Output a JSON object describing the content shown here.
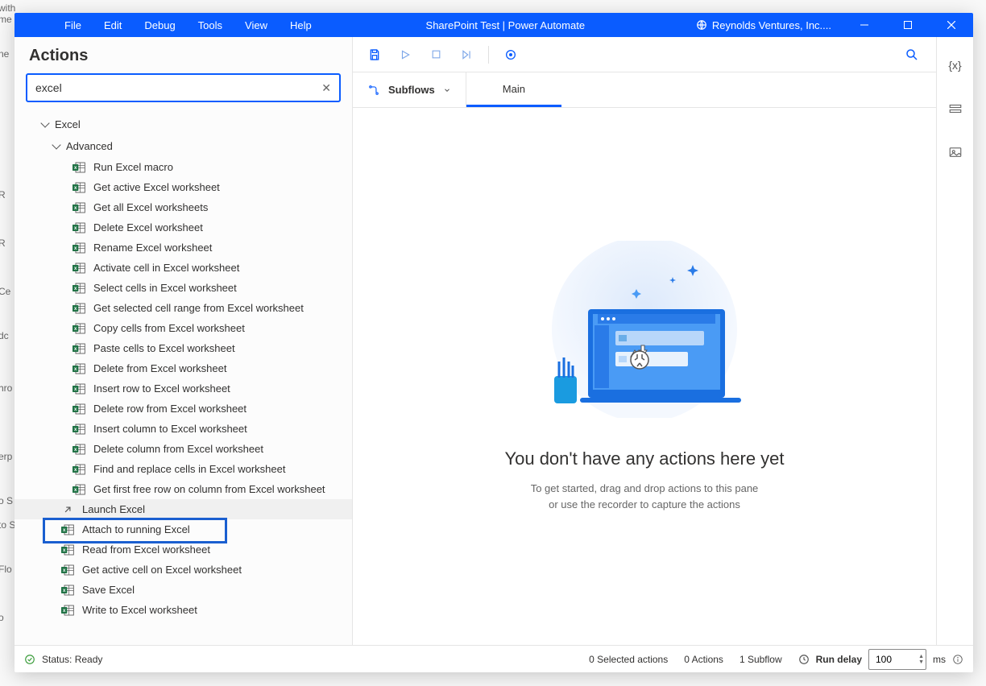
{
  "bg_fragments": [
    "with me",
    "ne",
    "R",
    "R",
    "Ce",
    "dc",
    "hro",
    "erp",
    "o S",
    "to S",
    "Flo",
    "o"
  ],
  "bg_positions": [
    3,
    60,
    235,
    295,
    355,
    410,
    475,
    560,
    615,
    645,
    700,
    760
  ],
  "titlebar": {
    "menus": [
      "File",
      "Edit",
      "Debug",
      "Tools",
      "View",
      "Help"
    ],
    "title": "SharePoint Test | Power Automate",
    "org": "Reynolds Ventures, Inc...."
  },
  "left": {
    "title": "Actions",
    "search_value": "excel",
    "group1": "Excel",
    "group2": "Advanced",
    "items_advanced": [
      "Run Excel macro",
      "Get active Excel worksheet",
      "Get all Excel worksheets",
      "Delete Excel worksheet",
      "Rename Excel worksheet",
      "Activate cell in Excel worksheet",
      "Select cells in Excel worksheet",
      "Get selected cell range from Excel worksheet",
      "Copy cells from Excel worksheet",
      "Paste cells to Excel worksheet",
      "Delete from Excel worksheet",
      "Insert row to Excel worksheet",
      "Delete row from Excel worksheet",
      "Insert column to Excel worksheet",
      "Delete column from Excel worksheet",
      "Find and replace cells in Excel worksheet",
      "Get first free row on column from Excel worksheet"
    ],
    "items_root": [
      "Launch Excel",
      "Attach to running Excel",
      "Read from Excel worksheet",
      "Get active cell on Excel worksheet",
      "Save Excel",
      "Write to Excel worksheet"
    ]
  },
  "tabs": {
    "subflows": "Subflows",
    "main": "Main"
  },
  "empty": {
    "title": "You don't have any actions here yet",
    "sub1": "To get started, drag and drop actions to this pane",
    "sub2": "or use the recorder to capture the actions"
  },
  "status": {
    "ready": "Status: Ready",
    "sel": "0 Selected actions",
    "actions": "0 Actions",
    "subflow": "1 Subflow",
    "delay_label": "Run delay",
    "delay_value": "100",
    "delay_unit": "ms"
  }
}
